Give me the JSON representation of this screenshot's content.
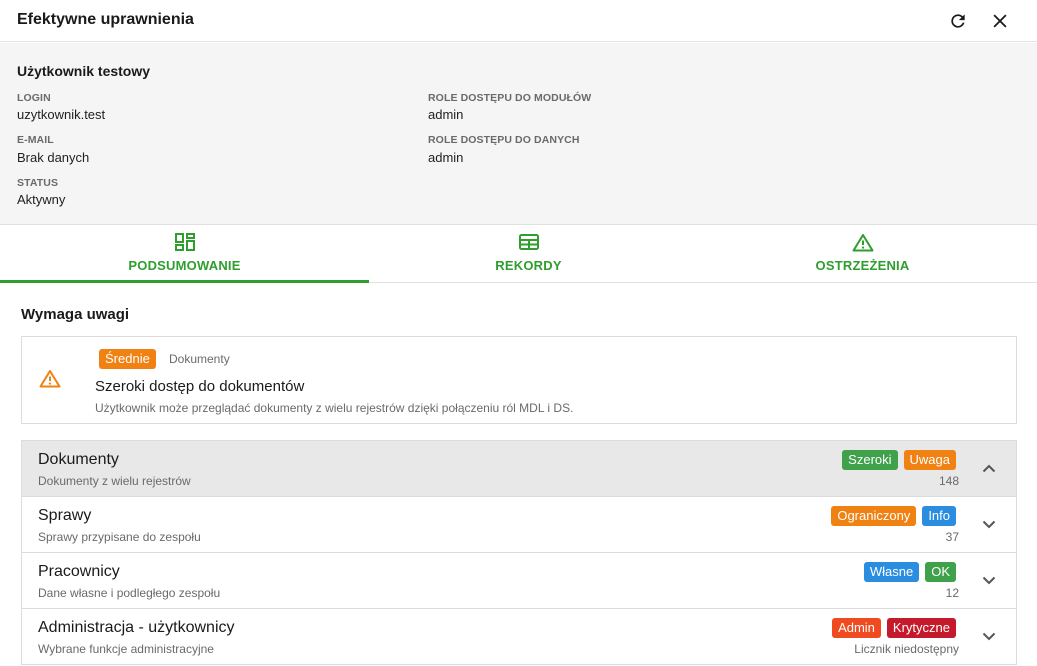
{
  "header": {
    "title": "Efektywne uprawnienia"
  },
  "user": {
    "name": "Użytkownik testowy",
    "login_label": "LOGIN",
    "login_value": "uzytkownik.test",
    "email_label": "E-MAIL",
    "email_value": "Brak danych",
    "status_label": "STATUS",
    "status_value": "Aktywny",
    "module_roles_label": "ROLE DOSTĘPU DO MODUŁÓW",
    "module_roles_value": "admin",
    "data_roles_label": "ROLE DOSTĘPU DO DANYCH",
    "data_roles_value": "admin"
  },
  "tabs": [
    {
      "label": "PODSUMOWANIE",
      "icon": "dashboard-icon",
      "active": true
    },
    {
      "label": "REKORDY",
      "icon": "table-icon",
      "active": false
    },
    {
      "label": "OSTRZEŻENIA",
      "icon": "warning-icon",
      "active": false
    }
  ],
  "section": {
    "title": "Wymaga uwagi"
  },
  "alert": {
    "icon": "warning-icon",
    "severity": "Średnie",
    "category": "Dokumenty",
    "title": "Szeroki dostęp do dokumentów",
    "description": "Użytkownik może przeglądać dokumenty z wielu rejestrów dzięki połączeniu ról MDL i DS."
  },
  "rows": [
    {
      "title": "Dokumenty",
      "subtitle": "Dokumenty z wielu rejestrów",
      "badge1": "Szeroki",
      "badge2": "Uwaga",
      "count": "148",
      "expanded": true
    },
    {
      "title": "Sprawy",
      "subtitle": "Sprawy przypisane do zespołu",
      "badge1": "Ograniczony",
      "badge2": "Info",
      "count": "37",
      "expanded": false
    },
    {
      "title": "Pracownicy",
      "subtitle": "Dane własne i podległego zespołu",
      "badge1": "Własne",
      "badge2": "OK",
      "count": "12",
      "expanded": false
    },
    {
      "title": "Administracja - użytkownicy",
      "subtitle": "Wybrane funkcje administracyjne",
      "badge1": "Admin",
      "badge2": "Krytyczne",
      "count": "Licznik niedostępny",
      "expanded": false
    }
  ],
  "colors": {
    "accent": "#2e9e2e",
    "green_badge": "#3fa24a",
    "orange_badge": "#f08113",
    "blue_badge": "#2a8de0",
    "red_badge": "#ef4a20",
    "dark_red_badge": "#c51a2b"
  }
}
